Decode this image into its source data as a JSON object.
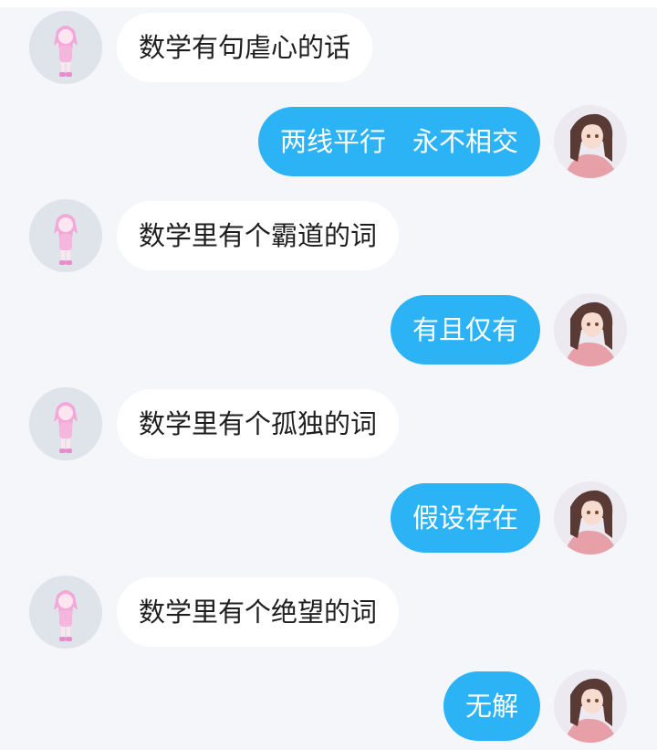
{
  "messages": [
    {
      "side": "left",
      "text": "数学有句虐心的话",
      "avatar": "pink-girl-avatar"
    },
    {
      "side": "right",
      "text": "两线平行　永不相交",
      "avatar": "anime-girl-avatar"
    },
    {
      "side": "left",
      "text": "数学里有个霸道的词",
      "avatar": "pink-girl-avatar"
    },
    {
      "side": "right",
      "text": "有且仅有",
      "avatar": "anime-girl-avatar"
    },
    {
      "side": "left",
      "text": "数学里有个孤独的词",
      "avatar": "pink-girl-avatar"
    },
    {
      "side": "right",
      "text": "假设存在",
      "avatar": "anime-girl-avatar"
    },
    {
      "side": "left",
      "text": "数学里有个绝望的词",
      "avatar": "pink-girl-avatar"
    },
    {
      "side": "right",
      "text": "无解",
      "avatar": "anime-girl-avatar"
    }
  ],
  "colors": {
    "background": "#f4f6f9",
    "incoming_bubble": "#ffffff",
    "outgoing_bubble": "#2bb3f5",
    "outgoing_text": "#ffffff",
    "incoming_text": "#1e1e1e"
  }
}
